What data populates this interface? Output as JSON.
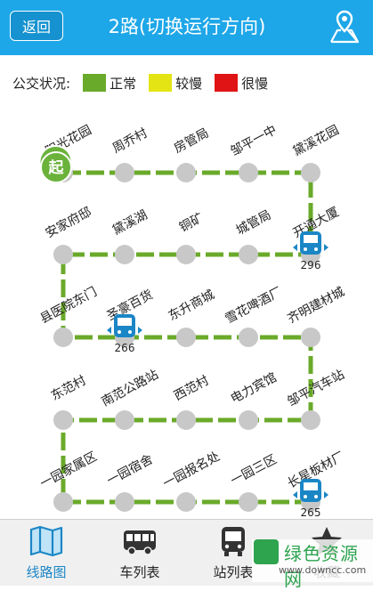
{
  "header": {
    "back_label": "返回",
    "title": "2路(切换运行方向)",
    "map_icon": "map-location-icon"
  },
  "legend": {
    "label": "公交状况:",
    "items": [
      {
        "name": "正常",
        "color": "#6aaa2a"
      },
      {
        "name": "较慢",
        "color": "#e4e415"
      },
      {
        "name": "很慢",
        "color": "#e01414"
      }
    ]
  },
  "route": {
    "start_label": "起",
    "rows": [
      [
        "阳光花园",
        "周乔村",
        "房管局",
        "邹平一中",
        "黛溪花园"
      ],
      [
        "安家府邸",
        "黛溪湖",
        "铜矿",
        "城管局",
        "开通大厦"
      ],
      [
        "县医院东门",
        "圣豪百货",
        "东升商城",
        "雪花啤酒厂",
        "齐明建材城"
      ],
      [
        "东范村",
        "南范公路站",
        "西范村",
        "电力宾馆",
        "邹平汽车站"
      ],
      [
        "一园家属区",
        "一园宿舍",
        "一园报名处",
        "一园三区",
        "长星板材厂"
      ]
    ],
    "buses": [
      {
        "number": "296",
        "row": 1,
        "col": 4
      },
      {
        "number": "266",
        "row": 2,
        "col": 1
      },
      {
        "number": "265",
        "row": 4,
        "col": 4
      }
    ]
  },
  "tabs": [
    {
      "label": "线路图",
      "icon": "route-map-icon",
      "active": true
    },
    {
      "label": "车列表",
      "icon": "bus-icon",
      "active": false
    },
    {
      "label": "站列表",
      "icon": "bus-stop-icon",
      "active": false
    },
    {
      "label": "收藏",
      "icon": "star-icon",
      "active": false
    }
  ],
  "watermark": {
    "text": "绿色资源网",
    "url": "www.downcc.com"
  }
}
